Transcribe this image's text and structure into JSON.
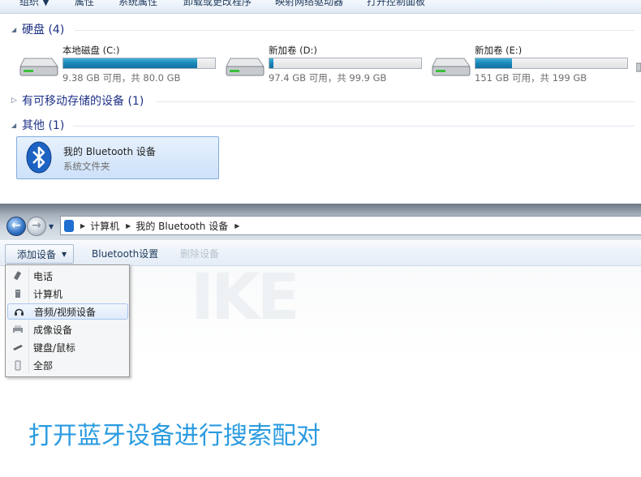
{
  "top_toolbar": {
    "items": [
      "组织 ▼",
      "属性",
      "系统属性",
      "卸载或更改程序",
      "映射网络驱动器",
      "打开控制面板"
    ]
  },
  "sections": {
    "hard_disks": "硬盘 (4)",
    "removable": "有可移动存储的设备 (1)",
    "other": "其他 (1)"
  },
  "drives": [
    {
      "name": "本地磁盘 (C:)",
      "info": "9.38 GB 可用，共 80.0 GB",
      "used_fraction": 0.883
    },
    {
      "name": "新加卷 (D:)",
      "info": "97.4 GB 可用，共 99.9 GB",
      "used_fraction": 0.025
    },
    {
      "name": "新加卷 (E:)",
      "info": "151 GB 可用，共 199 GB",
      "used_fraction": 0.241
    }
  ],
  "bluetooth_tile": {
    "title": "我的 Bluetooth 设备",
    "subtitle": "系统文件夹"
  },
  "address_bar": {
    "crumbs": [
      "计算机",
      "我的 Bluetooth 设备"
    ]
  },
  "command_bar": {
    "add_device": "添加设备",
    "bluetooth_settings": "Bluetooth设置",
    "delete_device": "删除设备"
  },
  "menu": {
    "items": [
      "电话",
      "计算机",
      "音频/视频设备",
      "成像设备",
      "键盘/鼠标",
      "全部"
    ],
    "highlighted": "音频/视频设备"
  },
  "caption": "打开蓝牙设备进行搜索配对",
  "colors": {
    "accent_blue": "#2a9be0",
    "drive_bar": "#1a86b8",
    "section_header": "#1e3287"
  }
}
